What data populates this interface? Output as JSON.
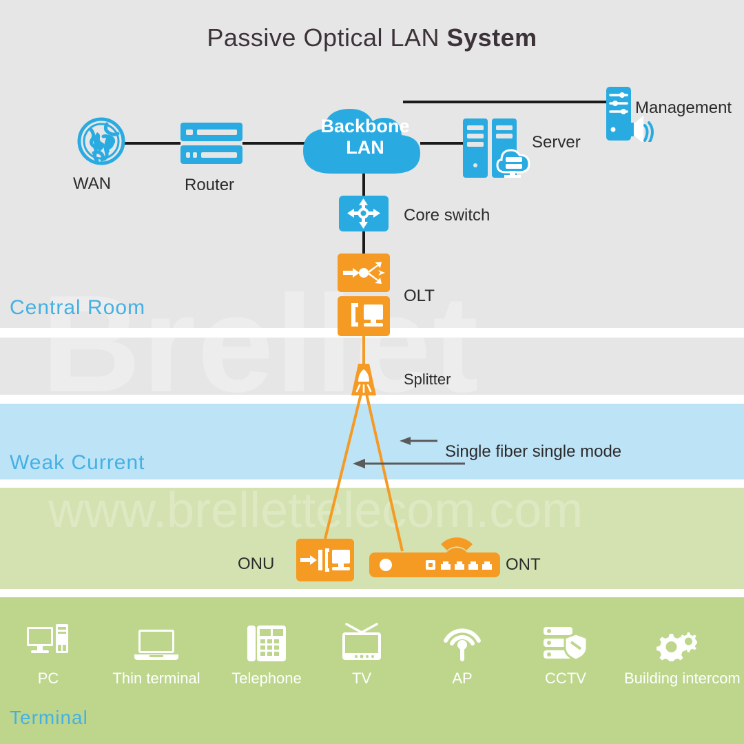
{
  "title": {
    "main": "Passive Optical LAN ",
    "emphasis": "System"
  },
  "colors": {
    "blue": "#29ABE2",
    "orange": "#F59A23",
    "zone_label_blue": "#45b0e3",
    "band_central": "#e6e6e6",
    "band_weak_current": "#bde3f7",
    "band_access": "#d3e2b0",
    "band_terminal": "#bdd68c",
    "link_black": "#1a1a1a",
    "link_orange": "#F59A23",
    "arrow_gray": "#5a5a5a",
    "title_text": "#3c3238"
  },
  "watermark": {
    "big": "Brellet",
    "url": "www.brellettelecom.com"
  },
  "zones": [
    {
      "name": "central-room",
      "label": "Central  Room"
    },
    {
      "name": "weak-current",
      "label": "Weak Current"
    },
    {
      "name": "terminal",
      "label": "Terminal"
    }
  ],
  "nodes": {
    "wan": {
      "label": "WAN",
      "icon": "globe-icon"
    },
    "router": {
      "label": "Router",
      "icon": "router-rack-icon"
    },
    "backbone": {
      "label_line1": "Backbone",
      "label_line2": "LAN",
      "icon": "cloud-icon"
    },
    "server": {
      "label": "Server",
      "icon": "server-tower-cloud-icon"
    },
    "management": {
      "label": "Management",
      "icon": "management-console-icon"
    },
    "core_switch": {
      "label": "Core switch",
      "icon": "core-switch-icon"
    },
    "olt": {
      "label": "OLT",
      "icon": "olt-icon"
    },
    "splitter": {
      "label": "Splitter",
      "icon": "splitter-icon"
    },
    "onu": {
      "label": "ONU",
      "icon": "onu-icon"
    },
    "ont": {
      "label": "ONT",
      "icon": "ont-router-wifi-icon"
    }
  },
  "annotations": {
    "fiber_link": "Single fiber single mode"
  },
  "terminals": [
    {
      "label": "PC",
      "icon": "desktop-pc-icon"
    },
    {
      "label": "Thin terminal",
      "icon": "laptop-icon"
    },
    {
      "label": "Telephone",
      "icon": "desk-phone-icon"
    },
    {
      "label": "TV",
      "icon": "television-icon"
    },
    {
      "label": "AP",
      "icon": "wifi-access-point-icon"
    },
    {
      "label": "CCTV",
      "icon": "cctv-storage-shield-icon"
    },
    {
      "label": "Building intercom",
      "icon": "gears-intercom-icon"
    }
  ]
}
